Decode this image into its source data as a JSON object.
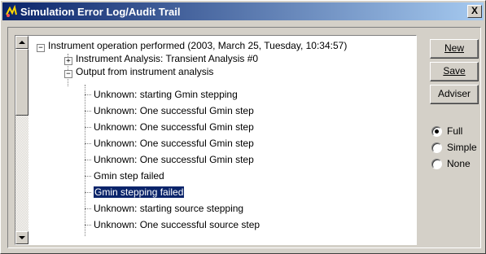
{
  "window": {
    "title": "Simulation Error Log/Audit Trail",
    "close_label": "X"
  },
  "tree": {
    "root": "Instrument operation performed  (2003, March 25, Tuesday, 10:34:57)",
    "child1": "Instrument Analysis: Transient Analysis #0",
    "child2": "Output from instrument analysis",
    "leaves": [
      "Unknown: starting Gmin stepping",
      "Unknown: One successful Gmin step",
      "Unknown: One successful Gmin step",
      "Unknown: One successful Gmin step",
      "Unknown: One successful Gmin step",
      "Gmin step failed",
      "Gmin stepping failed",
      "Unknown: starting source stepping",
      "Unknown: One successful source step"
    ],
    "selected_index": 6
  },
  "buttons": {
    "new_label": "New",
    "save_label": "Save",
    "adviser_label": "Adviser"
  },
  "radio": {
    "options": [
      "Full",
      "Simple",
      "None"
    ],
    "selected": "Full"
  }
}
